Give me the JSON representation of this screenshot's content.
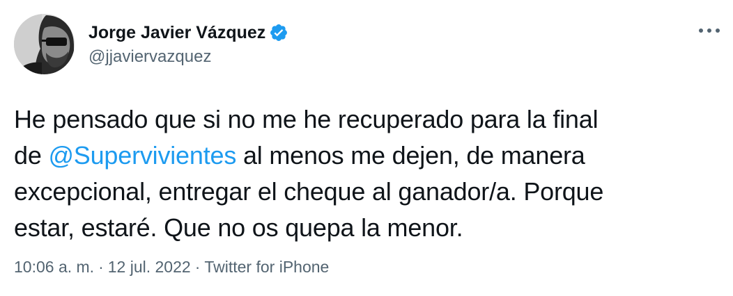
{
  "author": {
    "display_name": "Jorge Javier Vázquez",
    "handle": "@jjaviervazquez",
    "verified": true,
    "verified_color": "#1d9bf0"
  },
  "tweet": {
    "lines": [
      [
        {
          "text": "He pensado que si no me he recuperado para la final"
        }
      ],
      [
        {
          "text": "de "
        },
        {
          "text": "@Supervivientes",
          "mention": true
        },
        {
          "text": " al menos me dejen, de manera"
        }
      ],
      [
        {
          "text": "excepcional, entregar el cheque al ganador/a. Porque"
        }
      ],
      [
        {
          "text": "estar, estaré. Que no os quepa la menor."
        }
      ]
    ],
    "mention_color": "#1d9bf0"
  },
  "meta": {
    "time": "10:06 a. m.",
    "separator": "·",
    "date": "12 jul. 2022",
    "source": "Twitter for iPhone"
  },
  "icons": {
    "more": "more-horizontal-icon",
    "verified": "verified-badge-icon"
  }
}
